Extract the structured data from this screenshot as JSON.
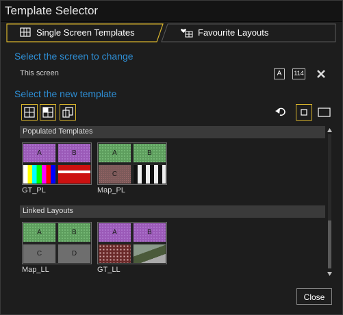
{
  "window": {
    "title": "Template Selector"
  },
  "tabs": [
    {
      "label": "Single Screen Templates",
      "icon": "grid-icon",
      "active": true
    },
    {
      "label": "Favourite Layouts",
      "icon": "heart-grid-icon",
      "active": false
    }
  ],
  "screen_section": {
    "heading": "Select the screen to change",
    "screen_label": "This screen",
    "a_button": "A",
    "number_button": "114"
  },
  "template_section": {
    "heading": "Select the new template"
  },
  "populated": {
    "header": "Populated Templates",
    "items": [
      {
        "label": "GT_PL",
        "cells": [
          "A",
          "B",
          "",
          ""
        ]
      },
      {
        "label": "Map_PL",
        "cells": [
          "A",
          "B",
          "C",
          ""
        ]
      }
    ]
  },
  "linked": {
    "header": "Linked Layouts",
    "items": [
      {
        "label": "Map_LL",
        "cells": [
          "A",
          "B",
          "C",
          "D"
        ]
      },
      {
        "label": "GT_LL",
        "cells": [
          "A",
          "B",
          "",
          ""
        ]
      }
    ]
  },
  "footer": {
    "close_label": "Close"
  },
  "colors": {
    "accent_gold": "#d8b42c",
    "heading_blue": "#2e8fd6"
  }
}
